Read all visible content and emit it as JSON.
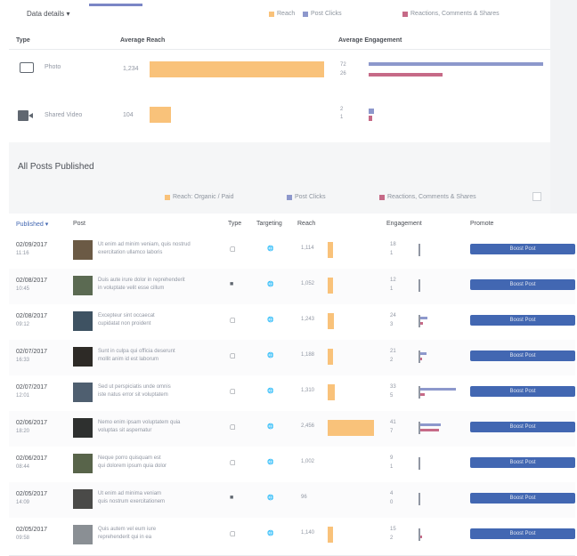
{
  "top_tab": {
    "label": "Data details ▾"
  },
  "legend_top": [
    {
      "label": "Reach",
      "color": "#f9c27a"
    },
    {
      "label": "Post Clicks",
      "color": "#8d98cc"
    },
    {
      "label": "Reactions, Comments & Shares",
      "color": "#c66a87"
    }
  ],
  "summary": {
    "headers": {
      "type": "Type",
      "avg_reach": "Average Reach",
      "avg_engagement": "Average Engagement"
    },
    "rows": [
      {
        "icon": "photo-icon",
        "label": "Photo",
        "reach_value": "1,234",
        "reach_frac": 0.99,
        "eng_values": [
          "72",
          "26"
        ],
        "eng_blue_frac": 0.99,
        "eng_pink_frac": 0.42
      },
      {
        "icon": "video-icon",
        "label": "Shared Video",
        "reach_value": "104",
        "reach_frac": 0.12,
        "eng_values": [
          "2",
          "1"
        ],
        "eng_blue_frac": 0.03,
        "eng_pink_frac": 0.02
      }
    ]
  },
  "all_posts": {
    "title": "All Posts Published",
    "legend": [
      {
        "label": "Reach: Organic / Paid",
        "color": "#f9c27a"
      },
      {
        "label": "Post Clicks",
        "color": "#8d98cc"
      },
      {
        "label": "Reactions, Comments & Shares",
        "color": "#c66a87"
      }
    ],
    "headers": {
      "published": "Published ▾",
      "post": "Post",
      "type": "Type",
      "targeting": "Targeting",
      "reach": "Reach",
      "engagement": "Engagement",
      "promote": "Promote"
    },
    "boost_label": "Boost Post",
    "rows": [
      {
        "date": "02/09/2017",
        "time": "11:16",
        "title1": "Ut enim ad minim veniam, quis nostrud",
        "title2": "exercitation ullamco laboris",
        "type": "▢",
        "target": "🌐",
        "reach": "1,114",
        "reach_frac": 0.05,
        "eng1": "18",
        "eng2": "1",
        "blue": 0.0,
        "pink": 0.0
      },
      {
        "date": "02/08/2017",
        "time": "10:45",
        "title1": "Duis aute irure dolor in reprehenderit",
        "title2": "in voluptate velit esse cillum",
        "type": "■",
        "target": "🌐",
        "reach": "1,052",
        "reach_frac": 0.02,
        "eng1": "12",
        "eng2": "1",
        "blue": 0.0,
        "pink": 0.0
      },
      {
        "date": "02/08/2017",
        "time": "09:12",
        "title1": "Excepteur sint occaecat",
        "title2": "cupidatat non proident",
        "type": "▢",
        "target": "🌐",
        "reach": "1,243",
        "reach_frac": 0.12,
        "eng1": "24",
        "eng2": "3",
        "blue": 0.18,
        "pink": 0.06
      },
      {
        "date": "02/07/2017",
        "time": "16:33",
        "title1": "Sunt in culpa qui officia deserunt",
        "title2": "mollit anim id est laborum",
        "type": "▢",
        "target": "🌐",
        "reach": "1,188",
        "reach_frac": 0.11,
        "eng1": "21",
        "eng2": "2",
        "blue": 0.16,
        "pink": 0.05
      },
      {
        "date": "02/07/2017",
        "time": "12:01",
        "title1": "Sed ut perspiciatis unde omnis",
        "title2": "iste natus error sit voluptatem",
        "type": "▢",
        "target": "🌐",
        "reach": "1,310",
        "reach_frac": 0.14,
        "eng1": "33",
        "eng2": "5",
        "blue": 0.95,
        "pink": 0.12
      },
      {
        "date": "02/06/2017",
        "time": "18:20",
        "title1": "Nemo enim ipsam voluptatem quia",
        "title2": "voluptas sit aspernatur",
        "type": "▢",
        "target": "🌐",
        "reach": "2,456",
        "reach_frac": 0.92,
        "eng1": "41",
        "eng2": "7",
        "blue": 0.55,
        "pink": 0.5
      },
      {
        "date": "02/06/2017",
        "time": "08:44",
        "title1": "Neque porro quisquam est",
        "title2": "qui dolorem ipsum quia dolor",
        "type": "▢",
        "target": "🌐",
        "reach": "1,002",
        "reach_frac": 0.0,
        "eng1": "9",
        "eng2": "1",
        "blue": 0.0,
        "pink": 0.0
      },
      {
        "date": "02/05/2017",
        "time": "14:09",
        "title1": "Ut enim ad minima veniam",
        "title2": "quis nostrum exercitationem",
        "type": "■",
        "target": "🌐",
        "reach": "96",
        "reach_frac": 0.0,
        "eng1": "4",
        "eng2": "0",
        "blue": 0.0,
        "pink": 0.0
      },
      {
        "date": "02/05/2017",
        "time": "09:58",
        "title1": "Quis autem vel eum iure",
        "title2": "reprehenderit qui in ea",
        "type": "▢",
        "target": "🌐",
        "reach": "1,140",
        "reach_frac": 0.1,
        "eng1": "15",
        "eng2": "2",
        "blue": 0.0,
        "pink": 0.05
      }
    ]
  }
}
